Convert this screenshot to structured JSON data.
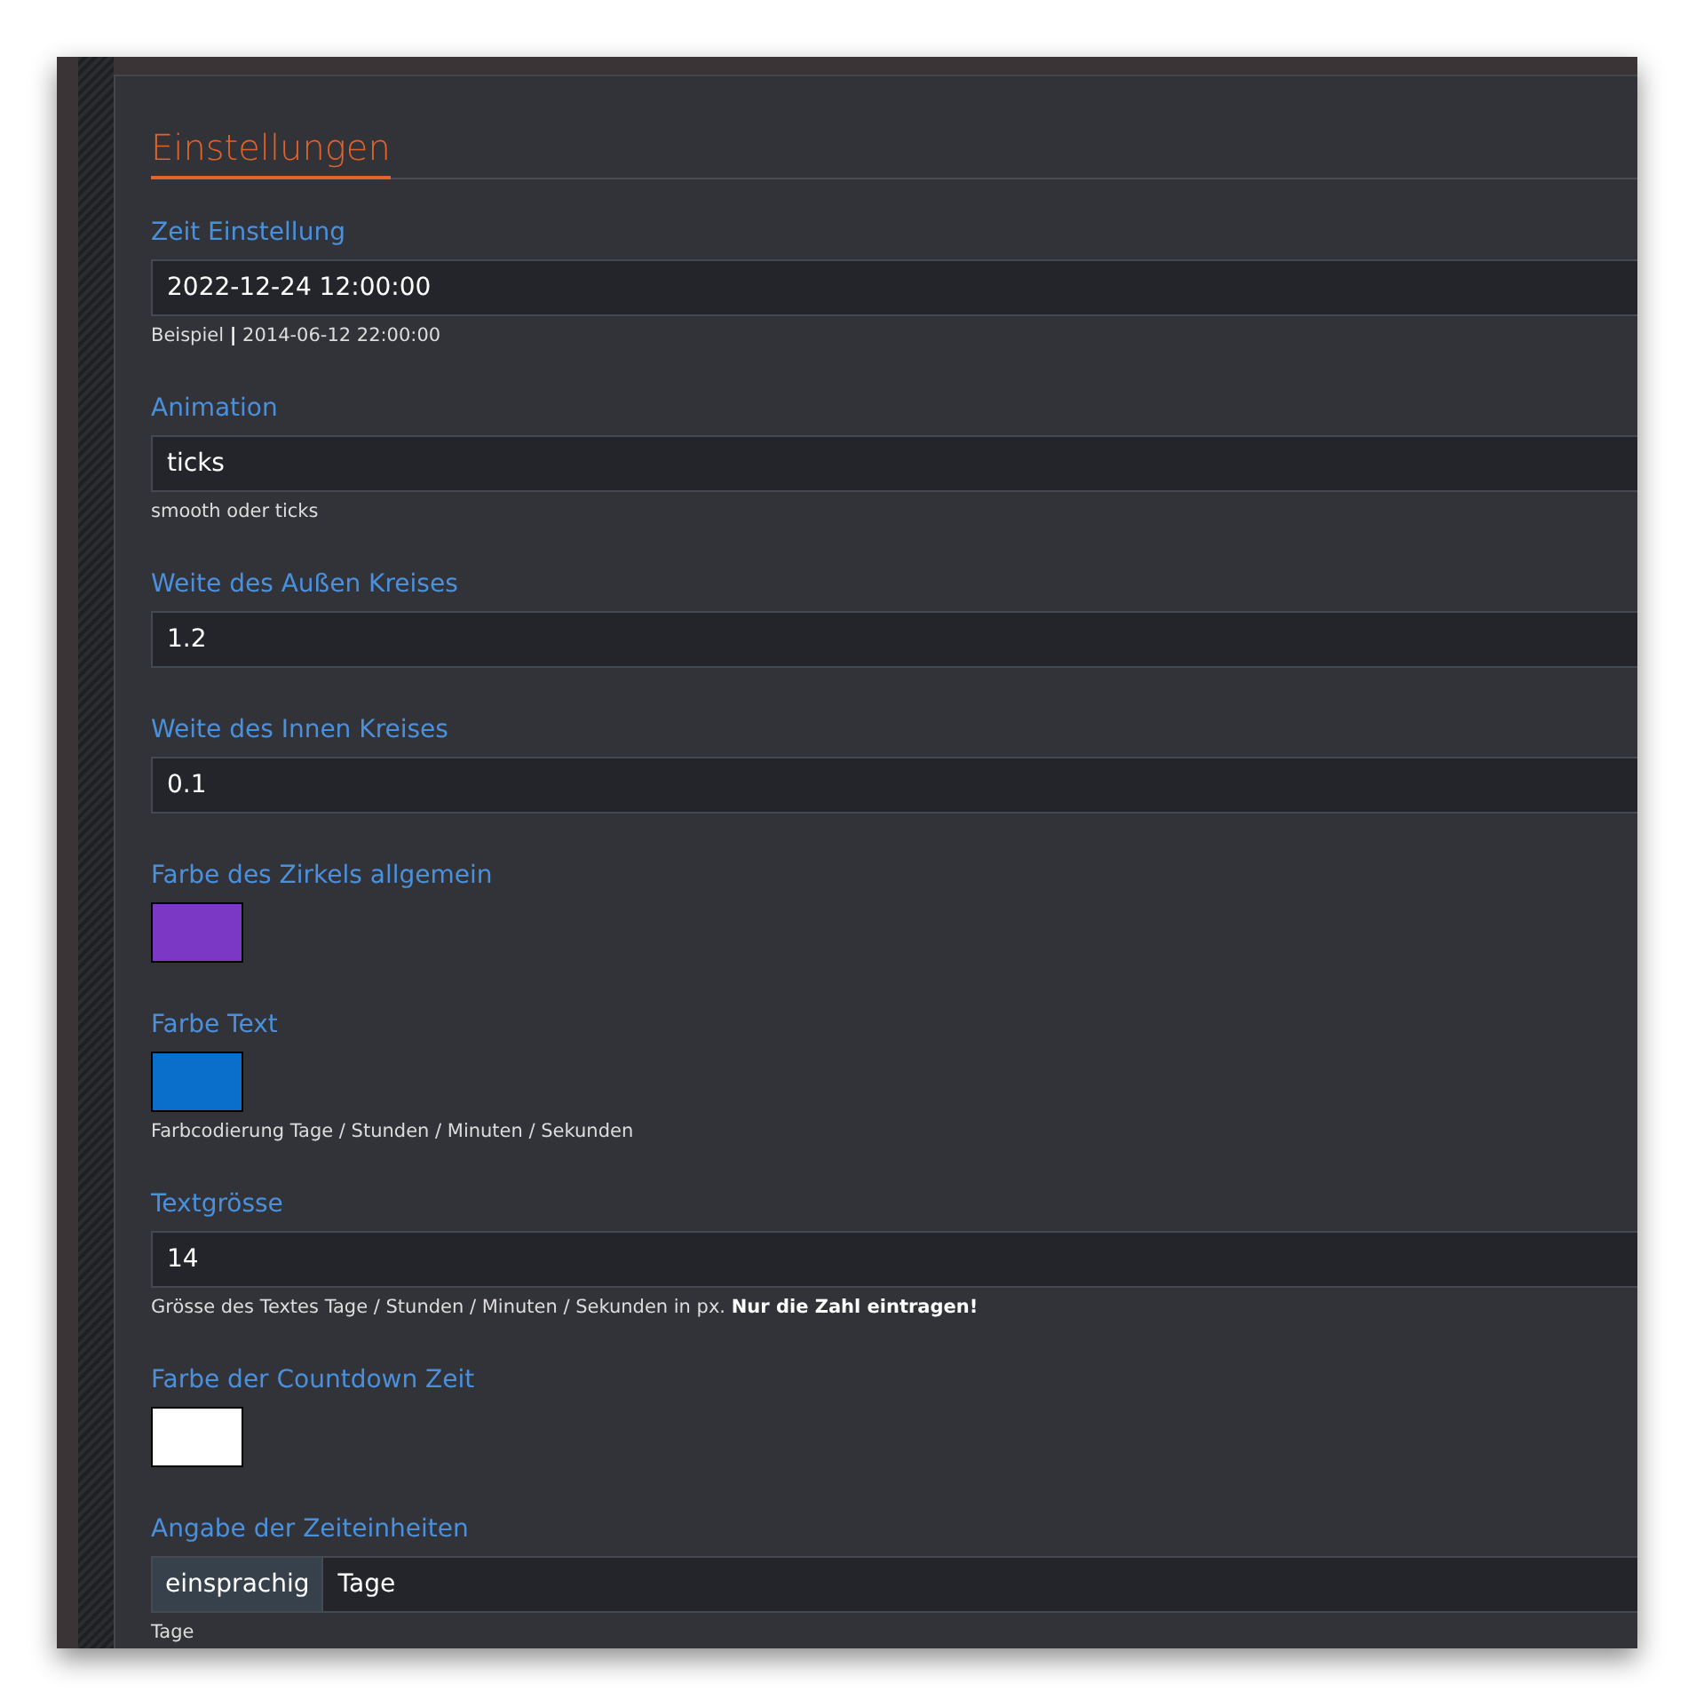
{
  "panel": {
    "title": "Einstellungen"
  },
  "fields": [
    {
      "kind": "text",
      "label": "Zeit Einstellung",
      "value": "2022-12-24 12:00:00",
      "help": "Beispiel **|** 2014-06-12 22:00:00"
    },
    {
      "kind": "text",
      "label": "Animation",
      "value": "ticks",
      "help": "smooth oder ticks"
    },
    {
      "kind": "text",
      "label": "Weite des Außen Kreises",
      "value": "1.2"
    },
    {
      "kind": "text",
      "label": "Weite des Innen Kreises",
      "value": "0.1"
    },
    {
      "kind": "color",
      "label": "Farbe des Zirkels allgemein",
      "color": "#7b38c4"
    },
    {
      "kind": "color",
      "label": "Farbe Text",
      "color": "#0a6fca",
      "help": "Farbcodierung Tage / Stunden / Minuten / Sekunden"
    },
    {
      "kind": "text",
      "label": "Textgrösse",
      "value": "14",
      "help": "Grösse des Textes Tage / Stunden / Minuten / Sekunden in px. **Nur die Zahl eintragen!**"
    },
    {
      "kind": "color",
      "label": "Farbe der Countdown Zeit",
      "color": "#ffffff"
    },
    {
      "kind": "addon",
      "label": "Angabe der Zeiteinheiten",
      "addon": "einsprachig",
      "value": "Tage",
      "help": "Tage"
    }
  ]
}
